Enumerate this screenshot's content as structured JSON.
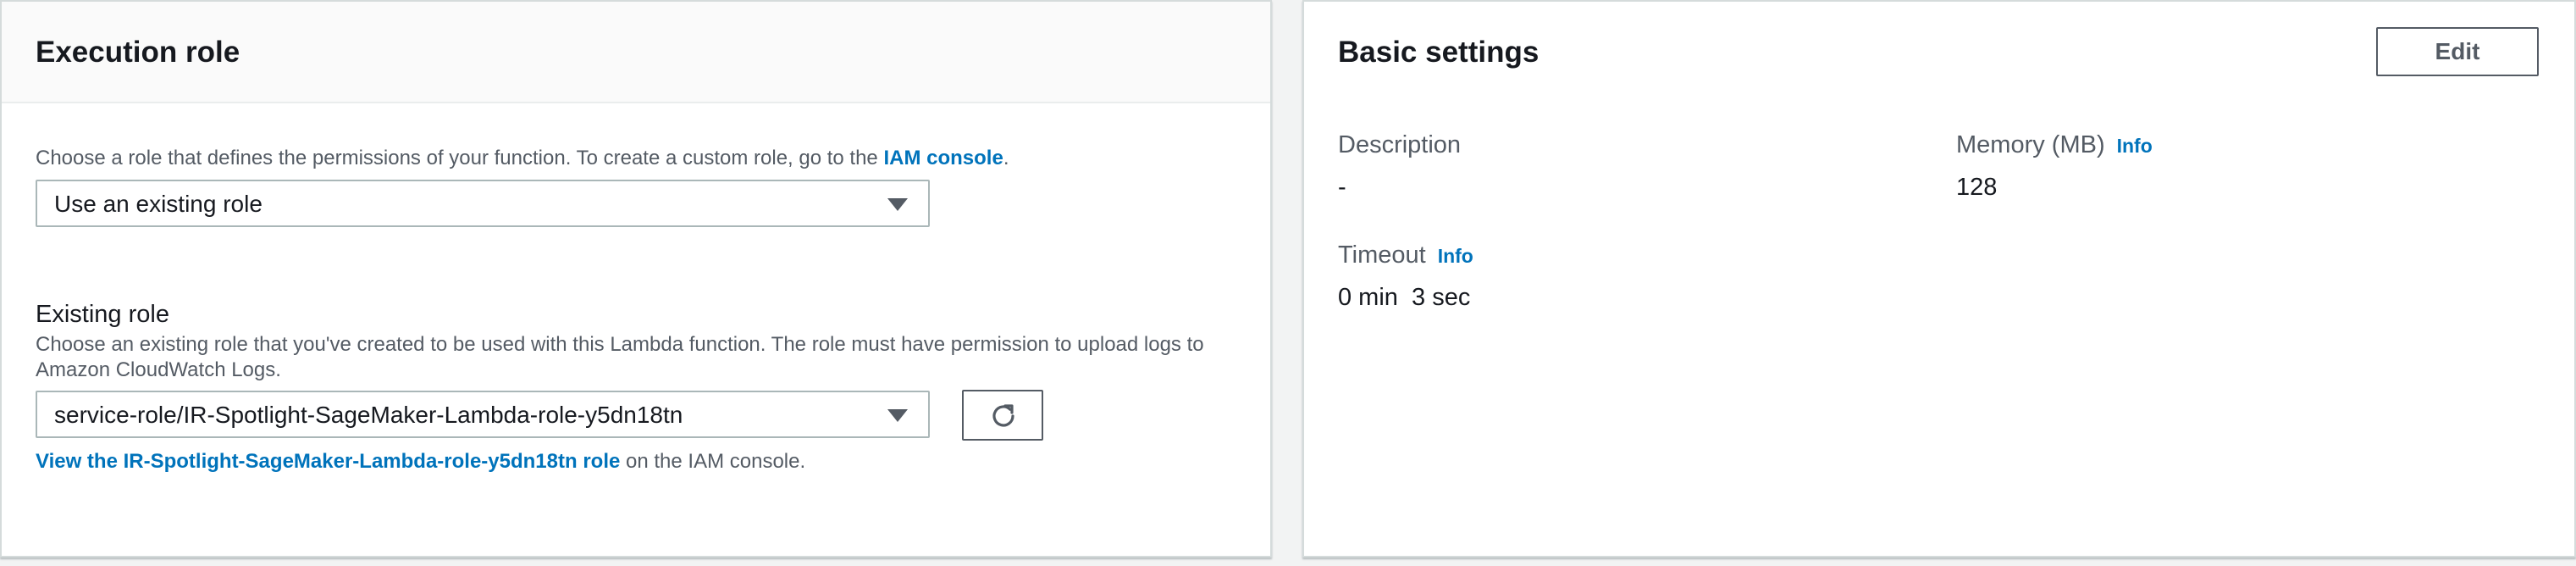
{
  "execution_role": {
    "title": "Execution role",
    "description_prefix": "Choose a role that defines the permissions of your function. To create a custom role, go to the ",
    "iam_console_link": "IAM console",
    "description_suffix": ".",
    "role_type_select": "Use an existing role",
    "existing_role_label": "Existing role",
    "existing_role_description_line1": "Choose an existing role that you've created to be used with this Lambda function. The role must have permission to upload logs to",
    "existing_role_description_line2": "Amazon CloudWatch Logs.",
    "existing_role_select": "service-role/IR-Spotlight-SageMaker-Lambda-role-y5dn18tn",
    "refresh_icon": "refresh-icon",
    "view_role_link": "View the IR-Spotlight-SageMaker-Lambda-role-y5dn18tn role",
    "view_role_suffix": " on the IAM console."
  },
  "basic_settings": {
    "title": "Basic settings",
    "edit_label": "Edit",
    "description_label": "Description",
    "description_value": "-",
    "memory_label": "Memory (MB)",
    "memory_info": "Info",
    "memory_value": "128",
    "timeout_label": "Timeout",
    "timeout_info": "Info",
    "timeout_value": "0 min  3 sec"
  },
  "colors": {
    "link": "#0073bb",
    "text": "#16191f",
    "muted": "#545b64",
    "border": "#aab7b8",
    "background": "#f2f3f3"
  }
}
